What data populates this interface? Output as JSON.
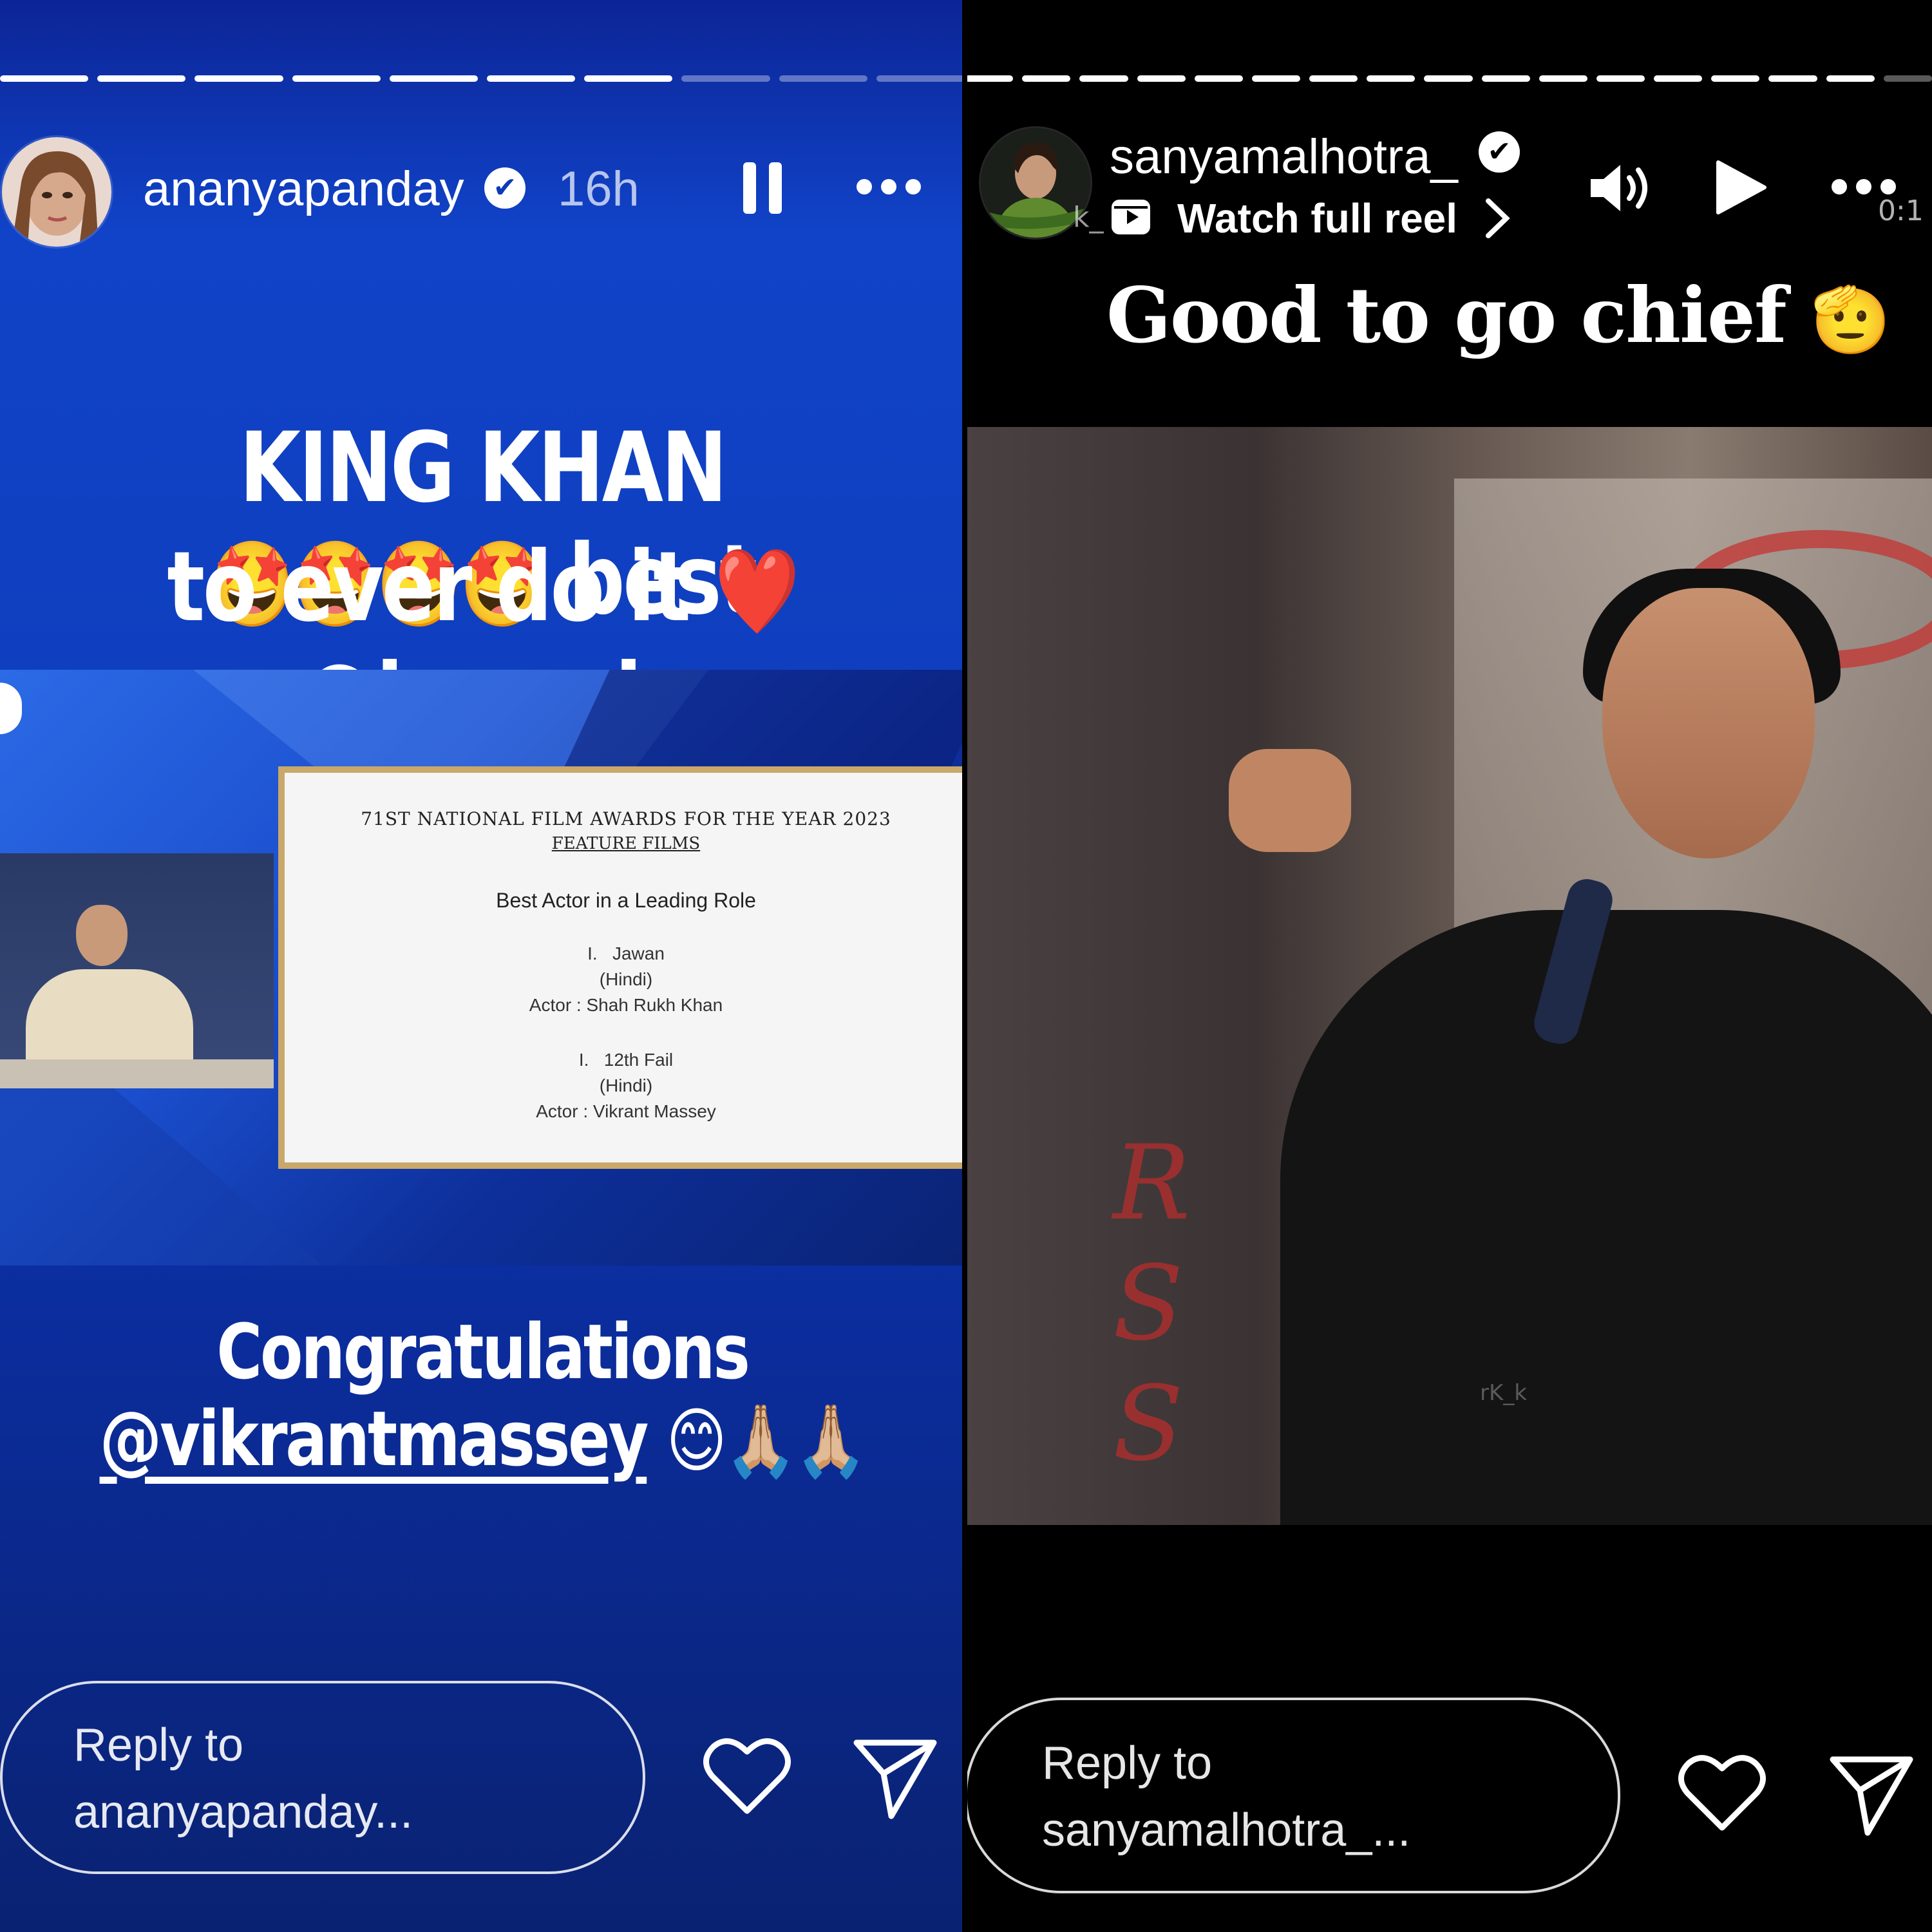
{
  "left_story": {
    "username": "ananyapanday",
    "verified": "✔",
    "time": "16h",
    "progress": {
      "total": 10,
      "completed": 7
    },
    "caption_line1": "KING KHAN",
    "emoji_star_struck": "🤩🤩🤩🤩",
    "caption_best": "best",
    "caption_line2": "to ever do it",
    "emoji_heart": "❤️",
    "mention_1": "@iamsrk",
    "award_card": {
      "title": "71ST NATIONAL FILM AWARDS FOR THE YEAR 2023",
      "subtitle": "FEATURE FILMS",
      "category": "Best Actor in a Leading Role",
      "entry1_num": "I.",
      "entry1_film": "Jawan",
      "entry1_lang": "(Hindi)",
      "entry1_actor": "Actor : Shah Rukh Khan",
      "entry2_num": "I.",
      "entry2_film": "12th Fail",
      "entry2_lang": "(Hindi)",
      "entry2_actor": "Actor : Vikrant Massey"
    },
    "congrats_line": "Congratulations",
    "mention_2": "@vikrantmassey",
    "emoji_smile_pray": "😊🙏🏼🙏🏼",
    "reply_placeholder_line1": "Reply to",
    "reply_placeholder_line2": "ananyapanday..."
  },
  "right_story": {
    "username": "sanyamalhotra_",
    "verified": "✔",
    "reel_link": "Watch full reel",
    "reel_prefix": "k_",
    "progress": {
      "total": 17,
      "completed": 16
    },
    "video_time": "0:1",
    "caption": "Good to go chief",
    "emoji_salute": "🫡",
    "reply_placeholder_line1": "Reply to",
    "reply_placeholder_line2": "sanyamalhotra_...",
    "watermark": "rK_k"
  },
  "colors": {
    "left_bg": "#1043c8",
    "right_bg": "#000000",
    "card_border": "#c9a86a",
    "text": "#ffffff"
  },
  "icons": [
    "verified-badge-icon",
    "pause-icon",
    "more-options-icon",
    "volume-icon",
    "play-icon",
    "heart-icon",
    "send-icon",
    "reel-icon",
    "chevron-right-icon"
  ]
}
